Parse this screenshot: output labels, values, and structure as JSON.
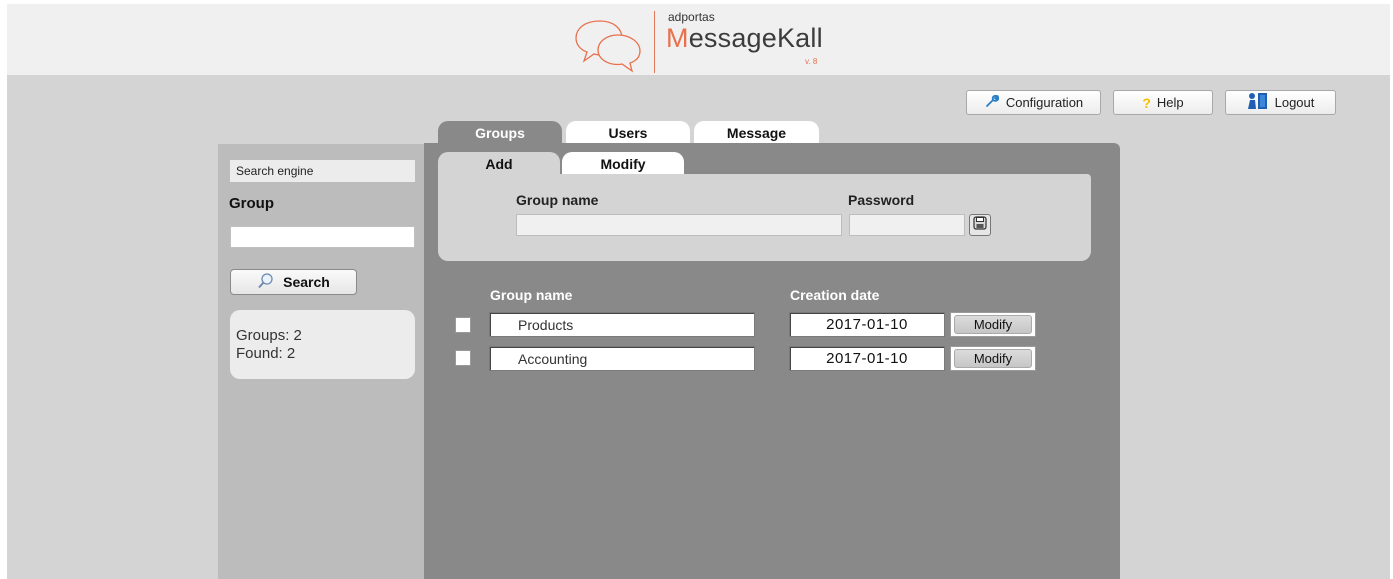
{
  "header": {
    "brand_small": "adportas",
    "brand_first_letter": "M",
    "brand_rest": "essageKall",
    "version": "v. 8"
  },
  "toolbar": {
    "configuration_label": "Configuration",
    "help_label": "Help",
    "logout_label": "Logout"
  },
  "sidebar": {
    "search_engine_label": "Search engine",
    "group_label": "Group",
    "group_input_value": "",
    "search_label": "Search",
    "groups_count_text": "Groups: 2",
    "found_count_text": "Found: 2"
  },
  "main_tabs": [
    {
      "label": "Groups"
    },
    {
      "label": "Users"
    },
    {
      "label": "Message"
    }
  ],
  "sub_tabs": [
    {
      "label": "Add"
    },
    {
      "label": "Modify"
    }
  ],
  "add_form": {
    "group_name_label": "Group name",
    "password_label": "Password",
    "group_name_value": "",
    "password_value": ""
  },
  "table": {
    "headers": [
      "Group name",
      "Creation date"
    ],
    "rows": [
      {
        "name": "Products",
        "date": "2017-01-10",
        "action": "Modify"
      },
      {
        "name": "Accounting",
        "date": "2017-01-10",
        "action": "Modify"
      }
    ]
  },
  "colors": {
    "accent": "#e8704c",
    "panel_dark": "#898989",
    "panel_light": "#d4d4d4"
  }
}
